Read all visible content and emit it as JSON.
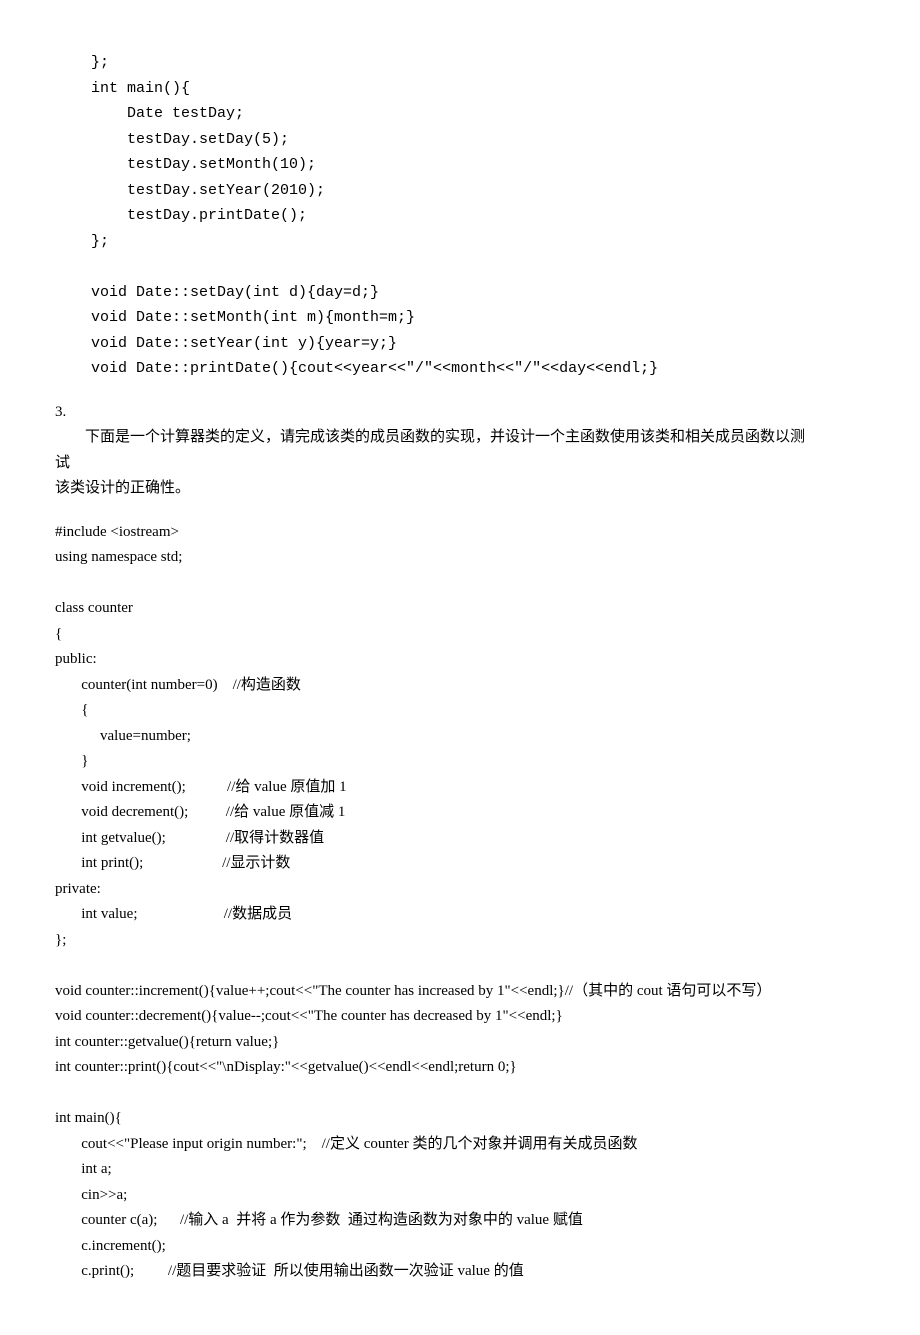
{
  "code1": "    };\n    int main(){\n        Date testDay;\n        testDay.setDay(5);\n        testDay.setMonth(10);\n        testDay.setYear(2010);\n        testDay.printDate();\n    };\n\n    void Date::setDay(int d){day=d;}\n    void Date::setMonth(int m){month=m;}\n    void Date::setYear(int y){year=y;}\n    void Date::printDate(){cout<<year<<\"/\"<<month<<\"/\"<<day<<endl;}",
  "section_num": "3.",
  "prose1": "        下面是一个计算器类的定义，请完成该类的成员函数的实现，并设计一个主函数使用该类和相关成员函数以测\n试\n该类设计的正确性。",
  "code2": "#include <iostream>\nusing namespace std;\n\nclass counter\n{\npublic:\n       counter(int number=0)    //构造函数\n       {\n            value=number;\n       }\n       void increment();           //给 value 原值加 1\n       void decrement();          //给 value 原值减 1\n       int getvalue();                //取得计数器值\n       int print();                     //显示计数\nprivate:\n       int value;                       //数据成员\n};\n\nvoid counter::increment(){value++;cout<<\"The counter has increased by 1\"<<endl;}//（其中的 cout 语句可以不写）\nvoid counter::decrement(){value--;cout<<\"The counter has decreased by 1\"<<endl;}\nint counter::getvalue(){return value;}\nint counter::print(){cout<<\"\\nDisplay:\"<<getvalue()<<endl<<endl;return 0;}\n\nint main(){\n       cout<<\"Please input origin number:\";    //定义 counter 类的几个对象并调用有关成员函数\n       int a;\n       cin>>a;\n       counter c(a);      //输入 a  并将 a 作为参数  通过构造函数为对象中的 value 赋值\n       c.increment();\n       c.print();         //题目要求验证  所以使用输出函数一次验证 value 的值"
}
